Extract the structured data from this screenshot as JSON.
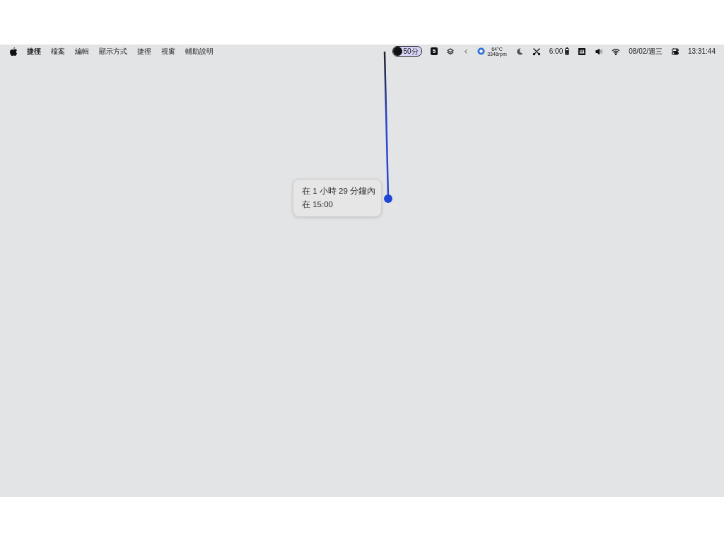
{
  "menu_bar": {
    "app_menus": [
      {
        "label": "捷徑",
        "active": true
      },
      {
        "label": "檔案",
        "active": false
      },
      {
        "label": "編輯",
        "active": false
      },
      {
        "label": "顯示方式",
        "active": false
      },
      {
        "label": "捷徑",
        "active": false
      },
      {
        "label": "視窗",
        "active": false
      },
      {
        "label": "輔助說明",
        "active": false
      }
    ],
    "status_items": [
      {
        "kind": "timer",
        "text": "50分"
      },
      {
        "kind": "badge",
        "text": "5"
      },
      {
        "kind": "layers"
      },
      {
        "kind": "chevron"
      },
      {
        "kind": "fan",
        "text": "64°C",
        "subtext": "3346rpm"
      },
      {
        "kind": "moon"
      },
      {
        "kind": "scissors"
      },
      {
        "kind": "battery",
        "text": "6:00"
      },
      {
        "kind": "app"
      },
      {
        "kind": "volume"
      },
      {
        "kind": "wifi"
      },
      {
        "kind": "text",
        "text": "08/02/週三"
      },
      {
        "kind": "toggles"
      },
      {
        "kind": "text",
        "text": "13:31:44"
      }
    ]
  },
  "tooltip": {
    "lines": [
      "在 1 小時 29 分鐘內",
      "在 15:00"
    ]
  }
}
